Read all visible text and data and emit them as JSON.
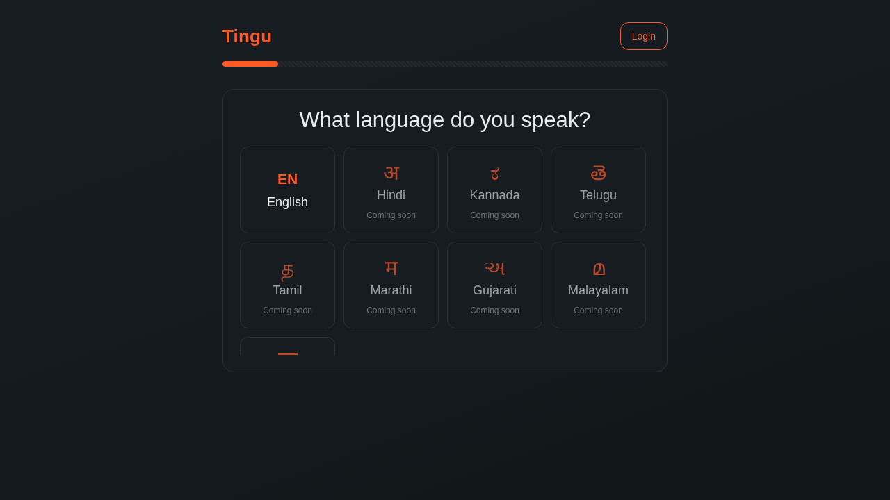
{
  "header": {
    "logo": "Tingu",
    "login_button": "Login"
  },
  "progress": {
    "level": 0.125
  },
  "panel": {
    "title": "What language do you speak?",
    "languages": [
      {
        "kind": "language",
        "glyph": "EN",
        "name": "English",
        "disabled": false
      },
      {
        "kind": "language",
        "glyph": "अ",
        "name": "Hindi",
        "note": "Coming soon",
        "disabled": true
      },
      {
        "kind": "language",
        "glyph": "ಕ",
        "name": "Kannada",
        "note": "Coming soon",
        "disabled": true
      },
      {
        "kind": "language",
        "glyph": "తె",
        "name": "Telugu",
        "note": "Coming soon",
        "disabled": true
      },
      {
        "kind": "language",
        "glyph": "த",
        "name": "Tamil",
        "note": "Coming soon",
        "disabled": true
      },
      {
        "kind": "language",
        "glyph": "म",
        "name": "Marathi",
        "note": "Coming soon",
        "disabled": true
      },
      {
        "kind": "language",
        "glyph": "અ",
        "name": "Gujarati",
        "note": "Coming soon",
        "disabled": true
      },
      {
        "kind": "language",
        "glyph": "മ",
        "name": "Malayalam",
        "note": "Coming soon",
        "disabled": true
      },
      {
        "kind": "partial"
      }
    ]
  }
}
